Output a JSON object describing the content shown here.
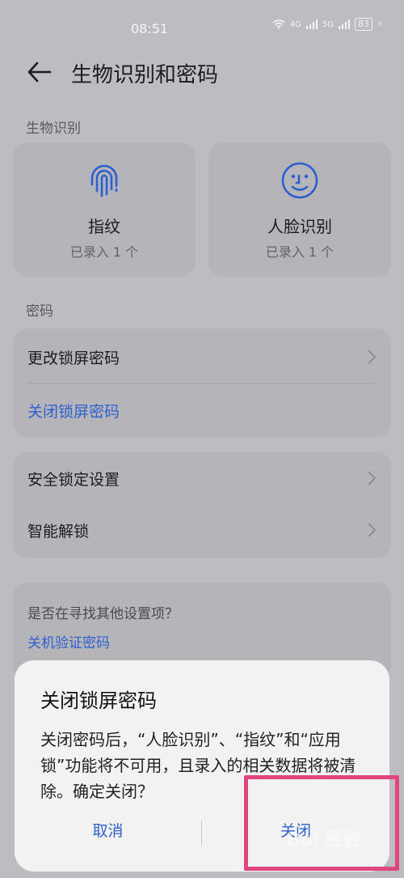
{
  "status_bar": {
    "time": "08:51",
    "signal1": "4G",
    "signal2": "5G",
    "battery": "83"
  },
  "header": {
    "title": "生物识别和密码",
    "back_icon": "arrow-left-icon"
  },
  "biometrics": {
    "section_label": "生物识别",
    "items": [
      {
        "icon": "fingerprint-icon",
        "name": "指纹",
        "status": "已录入 1 个"
      },
      {
        "icon": "face-icon",
        "name": "人脸识别",
        "status": "已录入 1 个"
      }
    ]
  },
  "password": {
    "section_label": "密码",
    "change_label": "更改锁屏密码",
    "close_label": "关闭锁屏密码"
  },
  "security": {
    "lock_settings_label": "安全锁定设置",
    "smart_unlock_label": "智能解锁"
  },
  "suggestion": {
    "question": "是否在寻找其他设置项？",
    "link": "关机验证密码"
  },
  "dialog": {
    "title": "关闭锁屏密码",
    "message": "关闭密码后，“人脸识别”、“指纹”和“应用锁”功能将不可用，且录入的相关数据将被清除。确定关闭？",
    "cancel_label": "取消",
    "confirm_label": "关闭"
  },
  "watermark": "Bai 经验",
  "colors": {
    "accent": "#2e5fd1",
    "highlight_border": "#e0457e"
  }
}
